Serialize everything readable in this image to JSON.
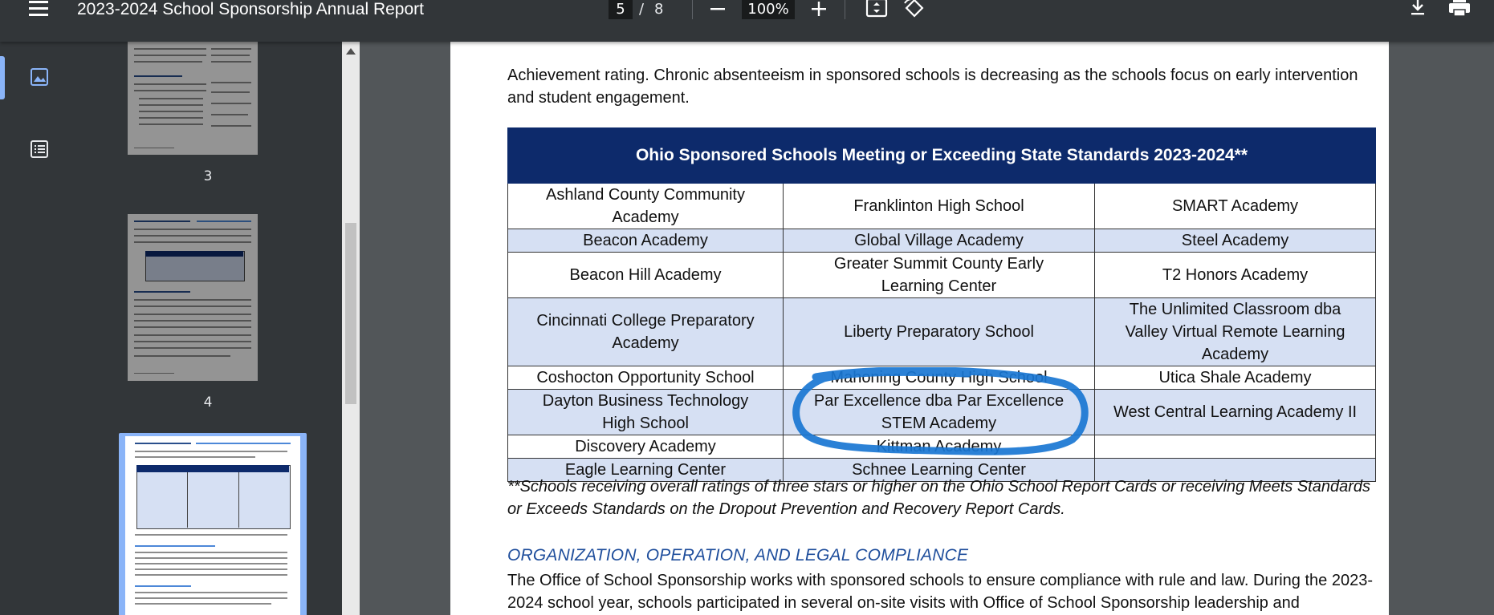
{
  "toolbar": {
    "title": "2023-2024 School Sponsorship Annual Report",
    "page_current": "5",
    "page_separator": "/",
    "page_total": "8",
    "zoom": "100%",
    "icons": [
      "menu-icon",
      "minus-icon",
      "plus-icon",
      "fit-page-icon",
      "rotate-icon",
      "download-icon",
      "print-icon"
    ]
  },
  "rail": {
    "icons": [
      "thumbnails-icon",
      "outline-icon"
    ],
    "accent": "#8ab4f8"
  },
  "thumbnails": [
    {
      "number": "3"
    },
    {
      "number": "4"
    }
  ],
  "document": {
    "intro": "Achievement rating. Chronic absenteeism in sponsored schools is decreasing as the schools focus on early intervention and student engagement.",
    "table": {
      "title": "Ohio Sponsored Schools Meeting or Exceeding State Standards 2023-2024**",
      "header_color": "#0d2a6b",
      "alt_row_color": "#d6e0f3",
      "rows": [
        [
          "Ashland County Community Academy",
          "Franklinton High School",
          "SMART Academy"
        ],
        [
          "Beacon Academy",
          "Global Village Academy",
          "Steel Academy"
        ],
        [
          "Beacon Hill Academy",
          "Greater Summit County Early Learning Center",
          "T2 Honors Academy"
        ],
        [
          "Cincinnati College Preparatory Academy",
          "Liberty Preparatory School",
          "The Unlimited Classroom dba Valley Virtual Remote Learning Academy"
        ],
        [
          "Coshocton Opportunity School",
          "Mahoning County High School",
          "Utica Shale Academy"
        ],
        [
          "Dayton Business Technology High School",
          "Par Excellence dba Par Excellence STEM Academy",
          "West Central Learning Academy II"
        ],
        [
          "Discovery Academy",
          "Kittman Academy",
          ""
        ],
        [
          "Eagle Learning Center",
          "Schnee Learning Center",
          ""
        ]
      ]
    },
    "footnote": "**Schools receiving overall ratings of three stars or higher on the Ohio School Report Cards or receiving Meets Standards or Exceeds Standards on the Dropout Prevention and Recovery Report Cards.",
    "section_heading": "ORGANIZATION, OPERATION, AND LEGAL COMPLIANCE",
    "section_body": "The Office of School Sponsorship works with sponsored schools to ensure compliance with rule and law. During the 2023-2024 school year, schools participated in several on-site visits with Office of School Sponsorship leadership and",
    "annotation_color": "#1976d2"
  }
}
